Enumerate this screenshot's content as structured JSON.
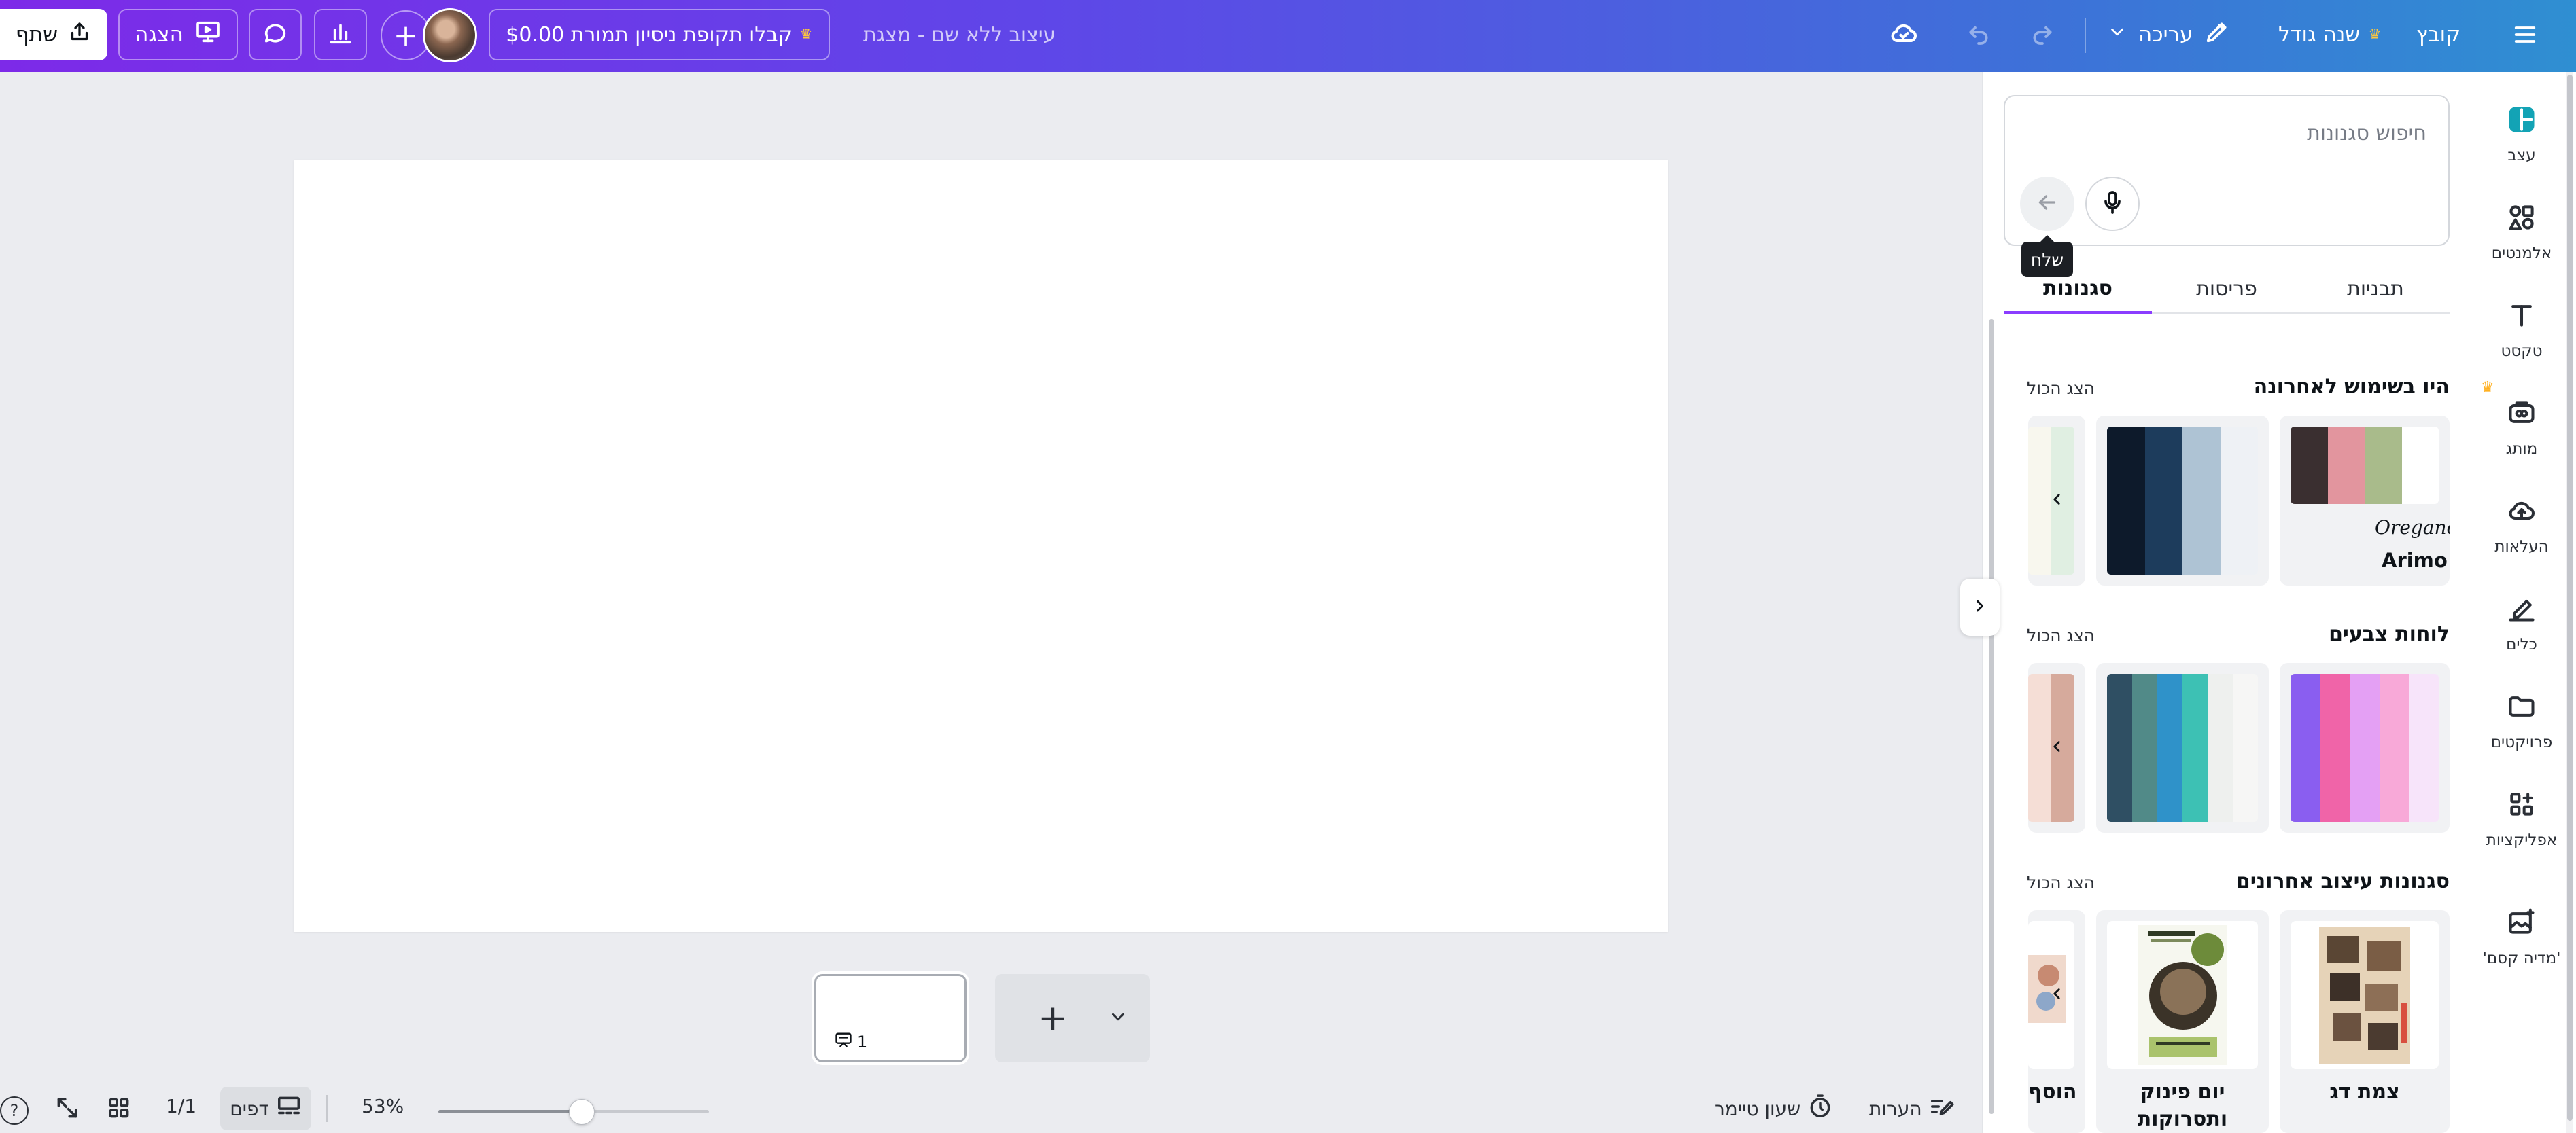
{
  "topbar": {
    "share_label": "שתף",
    "present_label": "הצגה",
    "trial_label": "קבלו תקופת ניסיון תמורת $0.00",
    "doc_title": "עיצוב ללא שם - מצגת",
    "edit_label": "עריכה",
    "resize_label": "שנה גודל",
    "file_label": "קובץ",
    "plus_symbol": "+"
  },
  "rail": {
    "items": [
      {
        "label": "עצב",
        "icon": "design-icon"
      },
      {
        "label": "אלמנטים",
        "icon": "elements-icon"
      },
      {
        "label": "טקסט",
        "icon": "text-icon"
      },
      {
        "label": "מותג",
        "icon": "brand-icon"
      },
      {
        "label": "העלאות",
        "icon": "upload-cloud-icon"
      },
      {
        "label": "כלים",
        "icon": "draw-tools-icon"
      },
      {
        "label": "פרויקטים",
        "icon": "folder-icon"
      },
      {
        "label": "אפליקציות",
        "icon": "apps-icon"
      },
      {
        "label": "'מדיה קסם'",
        "icon": "magic-media-icon"
      }
    ]
  },
  "panel": {
    "search_placeholder": "חיפוש סגנונות",
    "send_tooltip": "שלח",
    "tabs": [
      "תבניות",
      "פריסות",
      "סגנונות"
    ],
    "active_tab": "סגנונות",
    "sections": [
      {
        "title": "היו בשימוש לאחרונה",
        "see_all": "הצג הכול"
      },
      {
        "title": "לוחות צבעים",
        "see_all": "הצג הכול"
      },
      {
        "title": "סגנונות עיצוב אחרונים",
        "see_all": "הצג הכול"
      }
    ],
    "recent_style_fonts": [
      "Oregano",
      "Arimo"
    ],
    "recent_palettes": [
      [
        "#3a2f30",
        "#e2959e",
        "#a9bb8b",
        "#ffffff"
      ],
      [
        "#0d1a2b",
        "#1d3c5c",
        "#aec3d4",
        "#eef1f5"
      ],
      [
        "#f8f7ee",
        "#e0efe2"
      ]
    ],
    "color_palettes": [
      [
        "#8a5ef0",
        "#f064a8",
        "#e4a0f4",
        "#f8a9d8",
        "#f7e4fa"
      ],
      [
        "#2f4f63",
        "#518a88",
        "#2f92c9",
        "#3dc1b4",
        "#eef0ee",
        "#f6f6f5"
      ],
      [
        "#f5ded6",
        "#d6aa9c"
      ]
    ],
    "design_styles": [
      {
        "label": "צמת דג"
      },
      {
        "label": "יום פינוק ותסרוקות"
      },
      {
        "label": "הוסף"
      }
    ]
  },
  "canvas": {
    "page_number": "1"
  },
  "bottombar": {
    "notes_label": "הערות",
    "timer_label": "שעון טיימר",
    "zoom_value": "53%",
    "zoom_level": 0.53,
    "pages_label": "דפים",
    "page_count": "1/1",
    "help_label": "?"
  }
}
